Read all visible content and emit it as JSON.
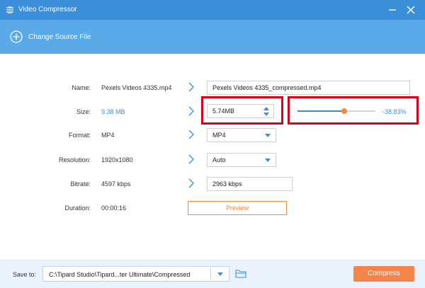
{
  "window": {
    "title": "Video Compressor",
    "accent_color": "#3a8fd8",
    "toolbar_color": "#5aa9e8"
  },
  "toolbar": {
    "change_source_label": "Change Source File",
    "icon": "plus-circle-icon"
  },
  "form": {
    "name": {
      "label": "Name:",
      "source_value": "Pexels Videos 4335.mp4",
      "output_value": "Pexels Videos 4335_compressed.mp4"
    },
    "size": {
      "label": "Size:",
      "source_value": "9.38 MB",
      "output_value": "5.74MB",
      "percent": "-38.83%",
      "slider_fraction": 0.6
    },
    "format": {
      "label": "Format:",
      "source_value": "MP4",
      "output_value": "MP4"
    },
    "resolution": {
      "label": "Resolution:",
      "source_value": "1920x1080",
      "output_value": "Auto"
    },
    "bitrate": {
      "label": "Bitrate:",
      "source_value": "4597 kbps",
      "output_value": "2963 kbps"
    },
    "duration": {
      "label": "Duration:",
      "source_value": "00:00:16"
    }
  },
  "preview": {
    "label": "Preview"
  },
  "bottom": {
    "save_to_label": "Save to:",
    "path": "C:\\Tipard Studio\\Tipard...ter Ultimate\\Compressed",
    "compress_label": "Compress",
    "compress_color": "#f5844a"
  },
  "highlight_color": "#d9001b"
}
